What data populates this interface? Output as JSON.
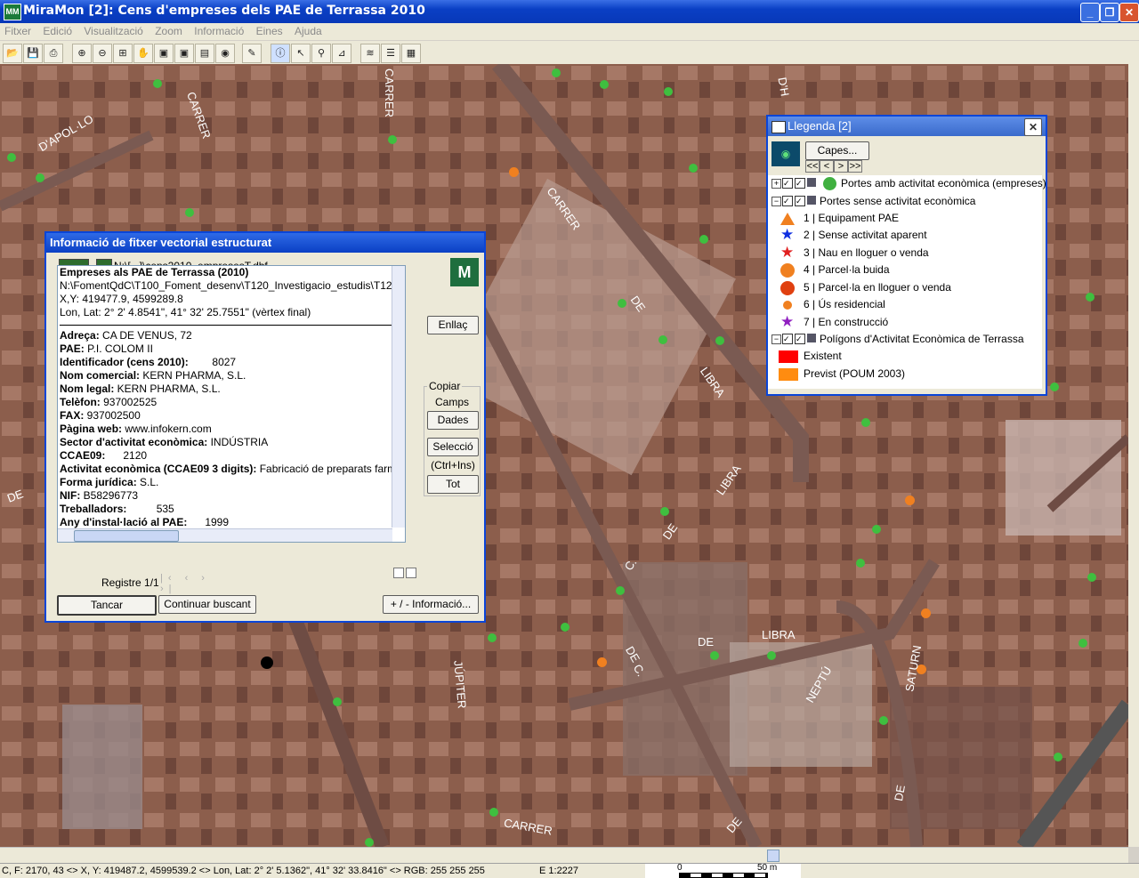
{
  "window": {
    "title": "MiraMon [2]:  Cens d'empreses dels PAE de Terrassa 2010",
    "app_icon": "MM"
  },
  "menu": [
    "Fitxer",
    "Edició",
    "Visualització",
    "Zoom",
    "Informació",
    "Eines",
    "Ajuda"
  ],
  "map": {
    "labels": [
      {
        "text": "CARRER"
      },
      {
        "text": "D'APOL·LO"
      },
      {
        "text": "CARRER"
      },
      {
        "text": "CARRER"
      },
      {
        "text": "DE"
      },
      {
        "text": "LIBRA"
      },
      {
        "text": "LIBRA"
      },
      {
        "text": "DE"
      },
      {
        "text": "C."
      },
      {
        "text": "DE"
      },
      {
        "text": "LIBRA"
      },
      {
        "text": "DE"
      },
      {
        "text": "C."
      },
      {
        "text": "NEPTÚ"
      },
      {
        "text": "SATURN"
      },
      {
        "text": "JÚPITER"
      },
      {
        "text": "CARRER"
      },
      {
        "text": "DE"
      },
      {
        "text": "DE"
      },
      {
        "text": "DE"
      },
      {
        "text": "D'H"
      }
    ]
  },
  "info_dialog": {
    "title": "Informació de fitxer vectorial estructurat",
    "file_path": "N:\\[...]\\cens2010_empresesT.dbf",
    "header_lines": [
      "Empreses als PAE de Terrassa (2010)",
      "N:\\FomentQdC\\T100_Foment_desenv\\T120_Investigacio_estudis\\T12",
      "X,Y: 419477.9, 4599289.8",
      "Lon, Lat: 2° 2' 4.8541\", 41° 32' 25.7551\" (vèrtex final)"
    ],
    "fields": [
      {
        "label": "Adreça:",
        "value": " CA DE VENUS, 72"
      },
      {
        "label": "PAE:",
        "value": " P.I. COLOM II"
      },
      {
        "label": "Identificador (cens 2010):",
        "value": "        8027"
      },
      {
        "label": "Nom comercial:",
        "value": " KERN PHARMA, S.L."
      },
      {
        "label": "Nom legal:",
        "value": " KERN PHARMA, S.L."
      },
      {
        "label": "Telèfon:",
        "value": " 937002525"
      },
      {
        "label": "FAX:",
        "value": " 937002500"
      },
      {
        "label": "Pàgina web:",
        "value": " www.infokern.com"
      },
      {
        "label": "Sector d'activitat econòmica:",
        "value": " INDÚSTRIA"
      },
      {
        "label": "CCAE09:",
        "value": "      2120"
      },
      {
        "label": "Activitat econòmica (CCAE09 3 digits):",
        "value": " Fabricació de preparats farma"
      },
      {
        "label": "Forma jurídica:",
        "value": " S.L."
      },
      {
        "label": "NIF:",
        "value": " B58296773"
      },
      {
        "label": "Treballadors:",
        "value": "          535"
      },
      {
        "label": "Any d'instal·lació al PAE:",
        "value": "      1999"
      }
    ],
    "buttons": {
      "enllac": "Enllaç",
      "copiar_group": "Copiar",
      "camps": "Camps",
      "dades": "Dades",
      "seleccio": "Selecció",
      "ctrl_ins": "(Ctrl+Ins)",
      "tot": "Tot",
      "tancar": "Tancar",
      "continuar": "Continuar buscant",
      "mes_info": "+ / - Informació..."
    },
    "registre": "Registre 1/1"
  },
  "legend": {
    "title": "Llegenda [2]",
    "capes_button": "Capes...",
    "nav": [
      "<<",
      "<",
      ">",
      ">>"
    ],
    "items": [
      {
        "kind": "layer",
        "label": "Portes amb activitat econòmica (empreses)",
        "symbol": "circle",
        "color": "#40b040",
        "expand": "+"
      },
      {
        "kind": "layer",
        "label": "Portes sense activitat econòmica",
        "expand": "−"
      },
      {
        "kind": "item",
        "label": "1 | Equipament PAE",
        "symbol": "triangle",
        "color": "#f08020"
      },
      {
        "kind": "item",
        "label": "2 | Sense activitat aparent",
        "symbol": "star",
        "color": "#1030e0"
      },
      {
        "kind": "item",
        "label": "3 | Nau en lloguer o venda",
        "symbol": "star",
        "color": "#e02020"
      },
      {
        "kind": "item",
        "label": "4 | Parcel·la buida",
        "symbol": "circle",
        "color": "#f08020"
      },
      {
        "kind": "item",
        "label": "5 | Parcel·la en lloguer o venda",
        "symbol": "circle",
        "color": "#e04010"
      },
      {
        "kind": "item",
        "label": "6 | Ús residencial",
        "symbol": "smallcircle",
        "color": "#f08020"
      },
      {
        "kind": "item",
        "label": "7 | En construcció",
        "symbol": "star",
        "color": "#9020c0"
      },
      {
        "kind": "layer",
        "label": "Polígons d'Activitat Econòmica de Terrassa",
        "expand": "−"
      },
      {
        "kind": "item",
        "label": "Existent",
        "symbol": "rect",
        "color": "#ff0000"
      },
      {
        "kind": "item",
        "label": "Previst (POUM 2003)",
        "symbol": "rect",
        "color": "#ff8c10"
      }
    ]
  },
  "status": {
    "coords": "C, F: 2170, 43 <> X, Y: 419487.2, 4599539.2 <> Lon, Lat: 2° 2' 5.1362\", 41° 32' 33.8416\" <> RGB:  255 255 255",
    "scale": "E 1:2227",
    "scalebar_start": "0",
    "scalebar_end": "50 m"
  }
}
